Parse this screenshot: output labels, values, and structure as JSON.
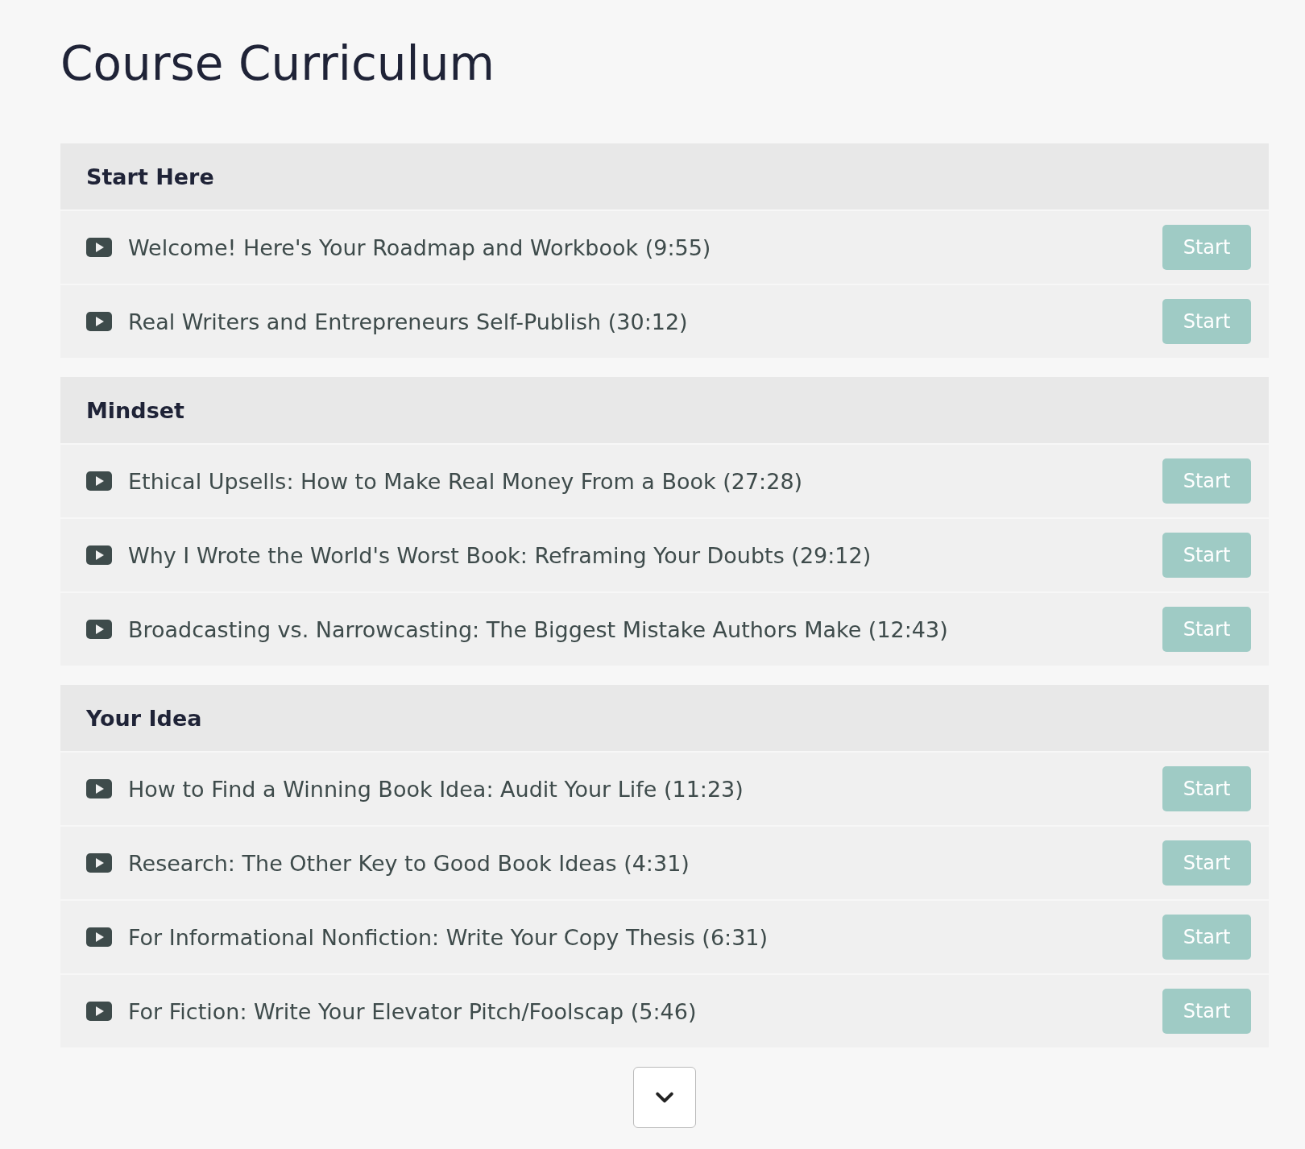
{
  "title": "Course Curriculum",
  "sections": [
    {
      "title": "Start Here",
      "lessons": [
        {
          "title": "Welcome! Here's Your Roadmap and Workbook (9:55)",
          "button": "Start"
        },
        {
          "title": "Real Writers and Entrepreneurs Self-Publish (30:12)",
          "button": "Start"
        }
      ]
    },
    {
      "title": "Mindset",
      "lessons": [
        {
          "title": "Ethical Upsells: How to Make Real Money From a Book (27:28)",
          "button": "Start"
        },
        {
          "title": "Why I Wrote the World's Worst Book: Reframing Your Doubts (29:12)",
          "button": "Start"
        },
        {
          "title": "Broadcasting vs. Narrowcasting: The Biggest Mistake Authors Make (12:43)",
          "button": "Start"
        }
      ]
    },
    {
      "title": "Your Idea",
      "lessons": [
        {
          "title": "How to Find a Winning Book Idea: Audit Your Life (11:23)",
          "button": "Start"
        },
        {
          "title": "Research: The Other Key to Good Book Ideas (4:31)",
          "button": "Start"
        },
        {
          "title": "For Informational Nonfiction: Write Your Copy Thesis (6:31)",
          "button": "Start"
        },
        {
          "title": "For Fiction: Write Your Elevator Pitch/Foolscap (5:46)",
          "button": "Start"
        }
      ]
    }
  ]
}
